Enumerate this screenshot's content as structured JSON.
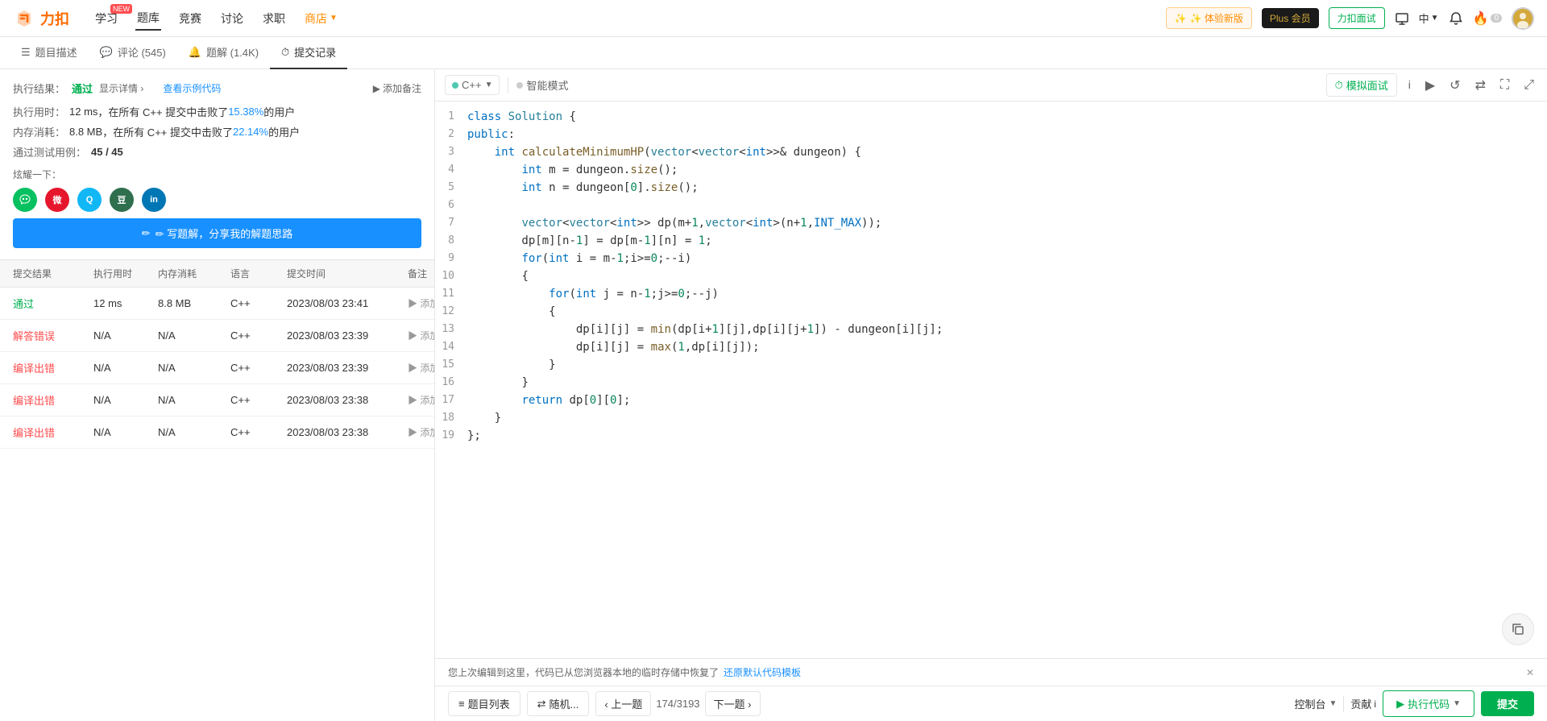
{
  "app": {
    "logo_text": "力扣",
    "nav_items": [
      {
        "label": "学习",
        "badge": "NEW",
        "active": false
      },
      {
        "label": "题库",
        "active": true
      },
      {
        "label": "竞赛",
        "active": false
      },
      {
        "label": "讨论",
        "active": false
      },
      {
        "label": "求职",
        "active": false
      },
      {
        "label": "商店",
        "active": false,
        "style": "shop",
        "has_arrow": true
      }
    ],
    "nav_right": {
      "experience_btn": "✨ 体验新版",
      "plus_btn": "Plus 会员",
      "interview_btn": "力扣面试",
      "lang": "中",
      "notification_count": "0"
    }
  },
  "tabs": [
    {
      "label": "题目描述",
      "icon": "☰",
      "active": false
    },
    {
      "label": "评论 (545)",
      "icon": "💬",
      "active": false
    },
    {
      "label": "题解 (1.4K)",
      "icon": "🔔",
      "active": false
    },
    {
      "label": "提交记录",
      "icon": "⏱",
      "active": true
    }
  ],
  "result": {
    "exec_result_label": "执行结果：",
    "status": "通过",
    "details_label": "显示详情 ›",
    "code_link": "查看示例代码",
    "add_note_label": "▶ 添加备注",
    "stats": [
      {
        "label": "执行用时：",
        "value": "12 ms",
        "suffix": " ，在所有 C++ 提交中击败了 ",
        "percent": "15.38%",
        "suffix2": " 的用户"
      },
      {
        "label": "内存消耗：",
        "value": "8.8 MB",
        "suffix": " ，在所有 C++ 提交中击败了 ",
        "percent": "22.14%",
        "suffix2": " 的用户"
      },
      {
        "label": "通过测试用例：",
        "value": "45 / 45"
      }
    ],
    "share_label": "炫耀一下：",
    "write_solution_btn": "✏ 写题解，分享我的解题思路"
  },
  "table": {
    "headers": [
      "提交结果",
      "执行用时",
      "内存消耗",
      "语言",
      "提交时间",
      "备注"
    ],
    "rows": [
      {
        "result": "通过",
        "result_type": "pass",
        "time": "12 ms",
        "memory": "8.8 MB",
        "lang": "C++",
        "submit_time": "2023/08/03 23:41",
        "note": "▶ 添加备注"
      },
      {
        "result": "解答错误",
        "result_type": "error",
        "time": "N/A",
        "memory": "N/A",
        "lang": "C++",
        "submit_time": "2023/08/03 23:39",
        "note": "▶ 添加备注"
      },
      {
        "result": "编译出错",
        "result_type": "error",
        "time": "N/A",
        "memory": "N/A",
        "lang": "C++",
        "submit_time": "2023/08/03 23:39",
        "note": "▶ 添加备注"
      },
      {
        "result": "编译出错",
        "result_type": "error",
        "time": "N/A",
        "memory": "N/A",
        "lang": "C++",
        "submit_time": "2023/08/03 23:38",
        "note": "▶ 添加备注"
      },
      {
        "result": "编译出错",
        "result_type": "error",
        "time": "N/A",
        "memory": "N/A",
        "lang": "C++",
        "submit_time": "2023/08/03 23:38",
        "note": "▶ 添加备注"
      }
    ]
  },
  "code_toolbar": {
    "lang": "C++",
    "mode": "智能模式",
    "mock_interview_btn": "⏱ 模拟面试",
    "icons": [
      "i",
      "▶",
      "↺",
      "⇄",
      "⛶",
      "⤢"
    ]
  },
  "code": {
    "lines": [
      {
        "num": 1,
        "content": "class Solution {"
      },
      {
        "num": 2,
        "content": "public:"
      },
      {
        "num": 3,
        "content": "    int calculateMinimumHP(vector<vector<int>>& dungeon) {"
      },
      {
        "num": 4,
        "content": "        int m = dungeon.size();"
      },
      {
        "num": 5,
        "content": "        int n = dungeon[0].size();"
      },
      {
        "num": 6,
        "content": ""
      },
      {
        "num": 7,
        "content": "        vector<vector<int>> dp(m+1,vector<int>(n+1,INT_MAX));"
      },
      {
        "num": 8,
        "content": "        dp[m][n-1] = dp[m-1][n] = 1;"
      },
      {
        "num": 9,
        "content": "        for(int i = m-1;i>=0;--i)"
      },
      {
        "num": 10,
        "content": "        {"
      },
      {
        "num": 11,
        "content": "            for(int j = n-1;j>=0;--j)"
      },
      {
        "num": 12,
        "content": "            {"
      },
      {
        "num": 13,
        "content": "                dp[i][j] = min(dp[i+1][j],dp[i][j+1]) - dungeon[i][j];"
      },
      {
        "num": 14,
        "content": "                dp[i][j] = max(1,dp[i][j]);"
      },
      {
        "num": 15,
        "content": "            }"
      },
      {
        "num": 16,
        "content": "        }"
      },
      {
        "num": 17,
        "content": "        return dp[0][0];"
      },
      {
        "num": 18,
        "content": "    }"
      },
      {
        "num": 19,
        "content": "};"
      }
    ]
  },
  "notification": {
    "text": "您上次编辑到这里，代码已从您浏览器本地的临时存储中恢复了",
    "restore_link": "还原默认代码模板"
  },
  "footer": {
    "problem_list_btn": "≡ 题目列表",
    "random_btn": "⇄ 随机...",
    "prev_btn": "‹ 上一题",
    "page_info": "174/3193",
    "next_btn": "下一题 ›",
    "console_btn": "控制台",
    "contribute_btn": "贡献 i",
    "run_code_btn": "▶ 执行代码",
    "submit_btn": "提交"
  }
}
